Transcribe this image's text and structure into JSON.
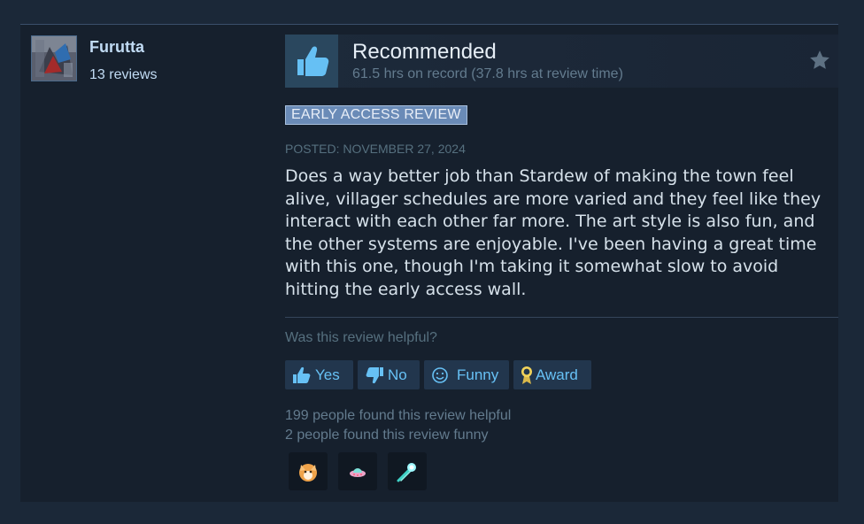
{
  "reviewer": {
    "name": "Furutta",
    "review_count": "13 reviews"
  },
  "review": {
    "verdict": "Recommended",
    "hours": "61.5 hrs on record (37.8 hrs at review time)",
    "badge": "EARLY ACCESS REVIEW",
    "posted": "POSTED: NOVEMBER 27, 2024",
    "body": "Does a way better job than Stardew of making the town feel alive, villager schedules are more varied and they feel like they interact with each other far more. The art style is also fun, and the other systems are enjoyable. I've been having a great time with this one, though I'm taking it somewhat slow to avoid hitting the early access wall."
  },
  "feedback": {
    "question": "Was this review helpful?",
    "yes_label": "Yes",
    "no_label": "No",
    "funny_label": "Funny",
    "award_label": "Award",
    "helpful_count": "199 people found this review helpful",
    "funny_count": "2 people found this review funny"
  },
  "awards": [
    "fox-award-icon",
    "alien-ship-award-icon",
    "comet-award-icon"
  ],
  "icons": {
    "thumb": "thumbs-up-icon",
    "star": "star-icon"
  },
  "colors": {
    "page_bg": "#1b2838",
    "card_bg": "#16202d",
    "link_blue": "#67c1f5",
    "badge_bg": "#6a8bb7"
  }
}
